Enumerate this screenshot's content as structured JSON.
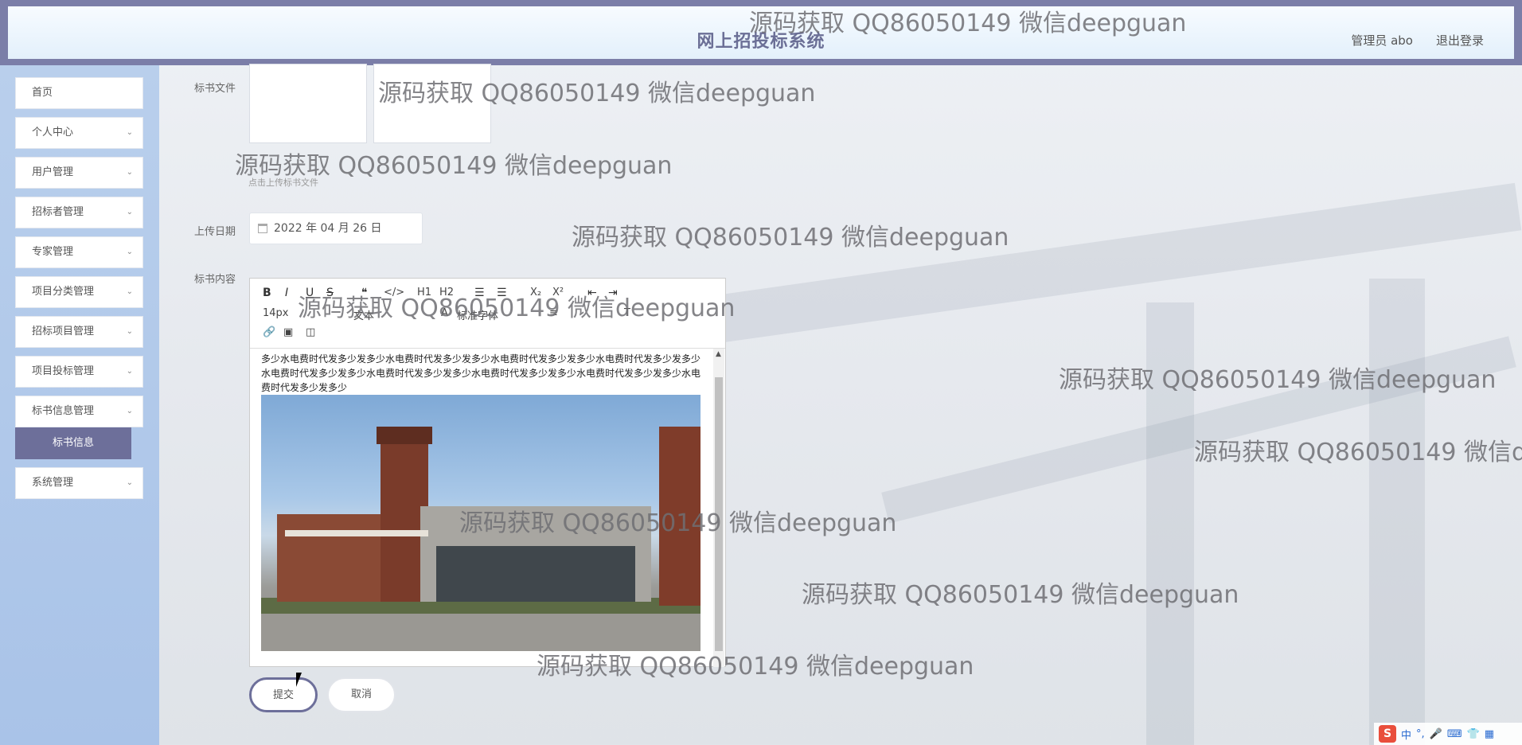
{
  "header": {
    "title": "网上招投标系统",
    "user": "管理员 abo",
    "logout": "退出登录"
  },
  "sidebar": {
    "items": [
      {
        "label": "首页",
        "chevron": false
      },
      {
        "label": "个人中心",
        "chevron": true
      },
      {
        "label": "用户管理",
        "chevron": true
      },
      {
        "label": "招标者管理",
        "chevron": true
      },
      {
        "label": "专家管理",
        "chevron": true
      },
      {
        "label": "项目分类管理",
        "chevron": true
      },
      {
        "label": "招标项目管理",
        "chevron": true
      },
      {
        "label": "项目投标管理",
        "chevron": true
      },
      {
        "label": "标书信息管理",
        "chevron": true
      },
      {
        "label": "系统管理",
        "chevron": true
      }
    ],
    "submenu_active": "标书信息"
  },
  "form": {
    "file_label": "标书文件",
    "file_hint": "点击上传标书文件",
    "date_label": "上传日期",
    "date_value": "2022 年 04 月 26 日",
    "content_label": "标书内容",
    "editor": {
      "toolbar_row1": [
        "B",
        "I",
        "U",
        "S",
        "❝",
        "</>",
        "H1",
        "H2",
        "☰",
        "☰",
        "X₂",
        "X²",
        "⇤",
        "⇥"
      ],
      "font_size": "14px",
      "font_style": "文本",
      "font_family": "标准字体",
      "content_text": "多少水电费时代发多少发多少水电费时代发多少发多少水电费时代发多少发多少水电费时代发多少发多少水电费时代发多少发多少水电费时代发多少发多少水电费时代发多少发多少水电费时代发多少发多少水电费时代发多少发多少"
    },
    "submit": "提交",
    "cancel": "取消"
  },
  "watermark": "源码获取 QQ86050149 微信deepguan",
  "ime": {
    "logo": "S",
    "lang": "中"
  },
  "colors": {
    "header_bar": "#7b7ea8",
    "sidebar": "#b9cfec",
    "active_submenu": "#6d6f9a"
  }
}
